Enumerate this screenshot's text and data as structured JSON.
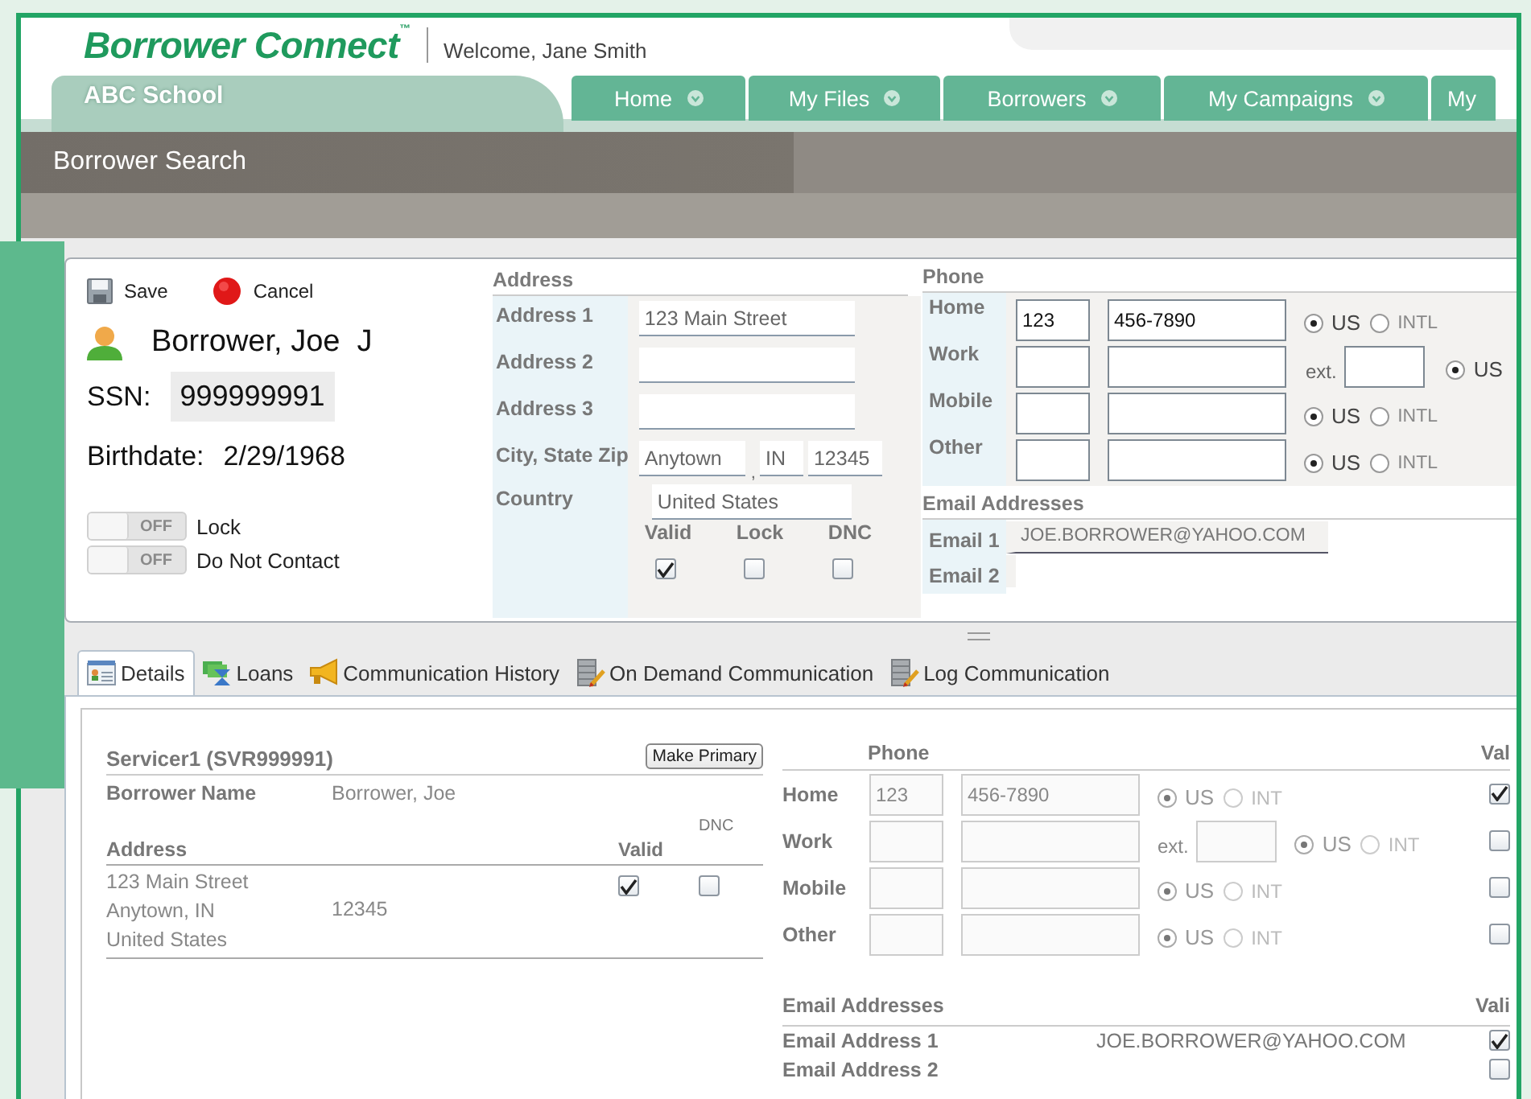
{
  "header": {
    "logo": "Borrower Connect$^{™}$",
    "welcome": "Welcome, Jane Smith"
  },
  "school_tab": "ABC School",
  "nav_tabs": [
    {
      "label": "Home",
      "selected": false
    },
    {
      "label": "My Files",
      "selected": false
    },
    {
      "label": "Borrowers",
      "selected": false
    },
    {
      "label": "My Campaigns",
      "selected": false
    },
    {
      "label": "My",
      "selected": false
    }
  ],
  "page_title": "Borrower Search",
  "actions": [
    {
      "kind": "save",
      "label": "Save"
    },
    {
      "kind": "cancel",
      "label": "Cancel"
    }
  ],
  "borrower": {
    "name": "Borrower, Joe  J",
    "ssn_label": "SSN:",
    "ssn": "999999991",
    "birthdate_label": "Birthdate:",
    "birthdate": "2/29/1968"
  },
  "toggles": [
    {
      "label": "Lock",
      "state_text": "OFF",
      "on": false
    },
    {
      "label": "Do Not Contact",
      "state_text": "OFF",
      "on": false
    }
  ],
  "address": {
    "title": "Address",
    "rows": [
      {
        "kind": "line",
        "label": "Address 1",
        "value": "123 Main Street"
      },
      {
        "kind": "line",
        "label": "Address 2"
      },
      {
        "kind": "line",
        "label": "Address 3"
      },
      {
        "kind": "city",
        "label": "City, State Zip",
        "city": "Anytown",
        "separator": ",",
        "state": "IN",
        "zip": "12345"
      },
      {
        "kind": "country",
        "label": "Country",
        "value": "United States"
      }
    ],
    "flags": [
      {
        "label": "Valid",
        "checked": true
      },
      {
        "label": "Lock",
        "checked": false
      },
      {
        "label": "DNC",
        "checked": false
      }
    ]
  },
  "phone": {
    "title": "Phone",
    "rows": [
      {
        "kind": "plain",
        "label": "Home",
        "area": "123",
        "number": "456-7890",
        "options": [
          {
            "label": "US",
            "selected": true
          },
          {
            "label": "INTL",
            "selected": false
          }
        ]
      },
      {
        "kind": "ext",
        "label": "Work",
        "ext_label": "ext.",
        "options": [
          {
            "label": "US",
            "selected": true
          }
        ]
      },
      {
        "kind": "plain",
        "label": "Mobile",
        "options": [
          {
            "label": "US",
            "selected": true
          },
          {
            "label": "INTL",
            "selected": false
          }
        ]
      },
      {
        "kind": "plain",
        "label": "Other",
        "options": [
          {
            "label": "US",
            "selected": true
          },
          {
            "label": "INTL",
            "selected": false
          }
        ]
      }
    ]
  },
  "email": {
    "title": "Email Addresses",
    "rows": [
      {
        "label": "Email 1",
        "value": "JOE.BORROWER@YAHOO.COM"
      },
      {
        "label": "Email 2"
      }
    ]
  },
  "detail_tabs": [
    {
      "kind": "details",
      "label": "Details",
      "selected": true
    },
    {
      "kind": "loans",
      "label": "Loans",
      "selected": false
    },
    {
      "kind": "history",
      "label": "Communication History",
      "selected": false
    },
    {
      "kind": "on_demand",
      "label": "On Demand Communication",
      "selected": false
    },
    {
      "kind": "log",
      "label": "Log Communication",
      "selected": false
    }
  ],
  "servicer": {
    "title": "Servicer1 (SVR999991)",
    "button": "Make Primary",
    "name_label": "Borrower Name",
    "name": "Borrower, Joe",
    "address_label": "Address",
    "valid_label": "Valid",
    "dnc_label": "DNC",
    "address_lines": [
      "123 Main Street",
      "Anytown, IN",
      "United States"
    ],
    "zip": "12345",
    "valid": true,
    "dnc": false
  },
  "servicer_phone": {
    "title": "Phone",
    "valid_label": "Val",
    "rows": [
      {
        "kind": "plain",
        "label": "Home",
        "area": "123",
        "number": "456-7890",
        "valid": true,
        "options": [
          {
            "label": "US",
            "selected": true
          },
          {
            "label": "INT",
            "selected": false
          }
        ]
      },
      {
        "kind": "ext",
        "label": "Work",
        "ext_label": "ext.",
        "valid": false,
        "options": [
          {
            "label": "US",
            "selected": true
          },
          {
            "label": "INT",
            "selected": false
          }
        ]
      },
      {
        "kind": "plain",
        "label": "Mobile",
        "valid": false,
        "options": [
          {
            "label": "US",
            "selected": true
          },
          {
            "label": "INT",
            "selected": false
          }
        ]
      },
      {
        "kind": "plain",
        "label": "Other",
        "valid": false,
        "options": [
          {
            "label": "US",
            "selected": true
          },
          {
            "label": "INT",
            "selected": false
          }
        ]
      }
    ]
  },
  "servicer_email": {
    "title": "Email Addresses",
    "valid_label": "Vali",
    "rows": [
      {
        "label": "Email Address 1",
        "value": "JOE.BORROWER@YAHOO.COM",
        "valid": true
      },
      {
        "label": "Email Address 2",
        "valid": false
      }
    ]
  }
}
